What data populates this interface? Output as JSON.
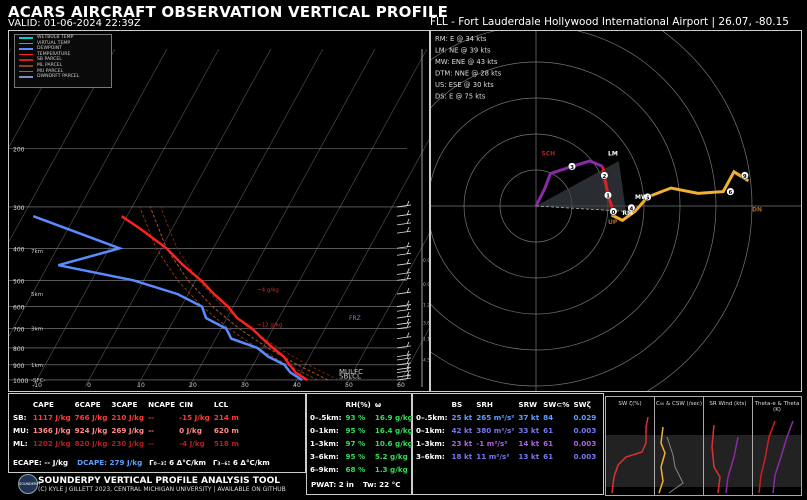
{
  "header": {
    "title": "ACARS AIRCRAFT OBSERVATION VERTICAL PROFILE",
    "valid": "VALID: 01-06-2024 22:39Z",
    "station": "FLL - Fort Lauderdale Hollywood International Airport | 26.07, -80.15"
  },
  "legend": [
    {
      "label": "WETBULB TEMP",
      "color": "#00d0d0"
    },
    {
      "label": "VIRTUAL TEMP",
      "color": "#ff5555"
    },
    {
      "label": "DEWPOINT",
      "color": "#5a8cff"
    },
    {
      "label": "TEMPERATURE",
      "color": "#ff2020"
    },
    {
      "label": "SB PARCEL",
      "color": "#cc2020"
    },
    {
      "label": "ML PARCEL",
      "color": "#884422"
    },
    {
      "label": "MU PARCEL",
      "color": "#aa6633"
    },
    {
      "label": "DWNDRFT PARCEL",
      "color": "#8888cc"
    }
  ],
  "chart_data": [
    {
      "type": "line",
      "name": "skew-t",
      "pressure_ticks": [
        200,
        300,
        400,
        500,
        600,
        700,
        800,
        900,
        1000
      ],
      "height_labels": [
        "7km",
        "5km",
        "3km",
        "1km",
        "2km"
      ],
      "sfc_label": "-SFC-",
      "temperature_ticks": [
        -20,
        -10,
        0,
        10,
        20,
        30,
        40,
        50,
        60
      ],
      "temperature_profile": [
        {
          "p": 1000,
          "t": 22
        },
        {
          "p": 950,
          "t": 19
        },
        {
          "p": 900,
          "t": 17
        },
        {
          "p": 850,
          "t": 15
        },
        {
          "p": 800,
          "t": 12
        },
        {
          "p": 750,
          "t": 9
        },
        {
          "p": 700,
          "t": 6
        },
        {
          "p": 650,
          "t": 2
        },
        {
          "p": 600,
          "t": -1
        },
        {
          "p": 550,
          "t": -5
        },
        {
          "p": 500,
          "t": -9
        },
        {
          "p": 450,
          "t": -14
        },
        {
          "p": 400,
          "t": -19
        },
        {
          "p": 350,
          "t": -26
        },
        {
          "p": 320,
          "t": -31
        }
      ],
      "dewpoint_profile": [
        {
          "p": 1000,
          "t": 21
        },
        {
          "p": 950,
          "t": 18
        },
        {
          "p": 900,
          "t": 16
        },
        {
          "p": 850,
          "t": 12
        },
        {
          "p": 800,
          "t": 9
        },
        {
          "p": 750,
          "t": 3
        },
        {
          "p": 700,
          "t": 1
        },
        {
          "p": 650,
          "t": -4
        },
        {
          "p": 600,
          "t": -6
        },
        {
          "p": 550,
          "t": -12
        },
        {
          "p": 500,
          "t": -22
        },
        {
          "p": 450,
          "t": -38
        },
        {
          "p": 400,
          "t": -28
        },
        {
          "p": 350,
          "t": -40
        },
        {
          "p": 320,
          "t": -48
        }
      ],
      "annotations": [
        {
          "text": "FRZ",
          "p": 650
        },
        {
          "text": "MULFC",
          "p": 960
        },
        {
          "text": "SBLCL",
          "p": 975
        },
        {
          "text": "~4 g/kg",
          "p": 540
        },
        {
          "text": "~12 g/kg",
          "p": 690
        }
      ],
      "hodo_speed_labels": [
        "0.9",
        "0.9",
        "1.2",
        "3.6",
        "1.1",
        "4.5"
      ]
    },
    {
      "type": "line",
      "name": "hodograph",
      "info": [
        "RM: E @ 34 kts",
        "LM: NE @ 39 kts",
        "MW: ENE @ 43 kts",
        "DTM: NNE @ 28 kts",
        "US: ESE @ 30 kts",
        "DS: E @ 75 kts"
      ],
      "height_labels": [
        "0",
        "1",
        "2",
        "3",
        "4",
        "5",
        "6",
        "9"
      ],
      "markers": [
        "LM",
        "RM",
        "MW",
        "DN",
        "UP",
        "SCH"
      ],
      "path": [
        {
          "u": 43,
          "v": -3
        },
        {
          "u": 40,
          "v": 6
        },
        {
          "u": 38,
          "v": 17
        },
        {
          "u": 37,
          "v": 22
        },
        {
          "u": 30,
          "v": 25
        },
        {
          "u": 20,
          "v": 22
        },
        {
          "u": 8,
          "v": 18
        },
        {
          "u": 5,
          "v": 10
        },
        {
          "u": 0,
          "v": 0
        }
      ],
      "upper_path": [
        {
          "u": 42,
          "v": -5
        },
        {
          "u": 48,
          "v": -8
        },
        {
          "u": 55,
          "v": -3
        },
        {
          "u": 62,
          "v": 5
        },
        {
          "u": 75,
          "v": 10
        },
        {
          "u": 90,
          "v": 7
        },
        {
          "u": 104,
          "v": 8
        },
        {
          "u": 110,
          "v": 19
        },
        {
          "u": 118,
          "v": 14
        }
      ]
    }
  ],
  "params_table": {
    "headers": [
      "CAPE",
      "6CAPE",
      "3CAPE",
      "NCAPE",
      "CIN",
      "LCL"
    ],
    "rows": [
      {
        "label": "SB:",
        "vals": [
          "1117 J/kg",
          "766 J/kg",
          "210 J/kg",
          "--",
          "-15 J/kg",
          "214 m"
        ]
      },
      {
        "label": "MU:",
        "vals": [
          "1366 J/kg",
          "924 J/kg",
          "269 J/kg",
          "--",
          "0 J/kg",
          "620 m"
        ]
      },
      {
        "label": "ML:",
        "vals": [
          "1202 J/kg",
          "820 J/kg",
          "230 J/kg",
          "--",
          "-4 J/kg",
          "518 m"
        ]
      }
    ],
    "ecape": "ECAPE: -- J/kg",
    "dcape": "DCAPE: 279 J/kg",
    "lapse03": "Γ₀₋₃: 6 Δ°C/km",
    "lapse36": "Γ₃₋₆: 6 Δ°C/km"
  },
  "moisture_table": {
    "headers": [
      "RH(%)",
      "ω"
    ],
    "rows": [
      {
        "label": "0–.5km:",
        "rh": "93 %",
        "w": "16.9 g/kg"
      },
      {
        "label": "0–1km:",
        "rh": "95 %",
        "w": "16.4 g/kg"
      },
      {
        "label": "1–3km:",
        "rh": "97 %",
        "w": "10.6 g/kg"
      },
      {
        "label": "3–6km:",
        "rh": "95 %",
        "w": "5.2 g/kg"
      },
      {
        "label": "6–9km:",
        "rh": "68 %",
        "w": "1.3 g/kg"
      }
    ],
    "pwat": "PWAT: 2 in",
    "tw": "Tw: 22 °C"
  },
  "kinematic_table": {
    "headers": [
      "BS",
      "SRH",
      "SRW",
      "SW⊂%",
      "SWζ"
    ],
    "rows": [
      {
        "label": "0–.5km:",
        "vals": [
          "25 kt",
          "265 m²/s²",
          "37 kt",
          "84",
          "0.029"
        ]
      },
      {
        "label": "0–1km:",
        "vals": [
          "42 kt",
          "380 m²/s²",
          "33 kt",
          "61",
          "0.003"
        ]
      },
      {
        "label": "1–3km:",
        "vals": [
          "23 kt",
          "-1 m²/s²",
          "14 kt",
          "61",
          "0.003"
        ]
      },
      {
        "label": "3–6km:",
        "vals": [
          "18 kt",
          "11 m²/s²",
          "13 kt",
          "61",
          "0.003"
        ]
      }
    ]
  },
  "mini_panels": [
    {
      "title": "SW ζ(%)"
    },
    {
      "title": "C₀₀ & CSW (/sec)"
    },
    {
      "title": "SR Wind (kts)"
    },
    {
      "title": "Theta-e & Theta (K)"
    }
  ],
  "footer": {
    "title": "SOUNDERPY VERTICAL PROFILE ANALYSIS TOOL",
    "credit": "(C) KYLE J GILLETT 2023, CENTRAL MICHIGAN UNIVERSITY | AVAILABLE ON GITHUB",
    "logo": "SOUNDERPY"
  },
  "colors": {
    "temperature": "#ff2020",
    "dewpoint": "#5a8cff",
    "hodo_low": "#dd2020",
    "hodo_mid": "#8a2aa8",
    "hodo_high": "#f0b030"
  }
}
